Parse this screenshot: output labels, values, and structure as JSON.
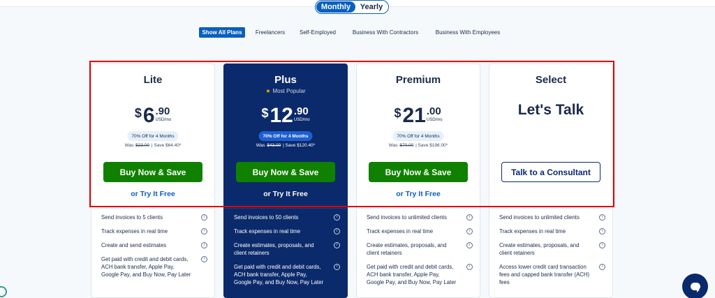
{
  "billing_toggle": {
    "monthly": "Monthly",
    "yearly": "Yearly"
  },
  "filters": [
    "Show All Plans",
    "Freelancers",
    "Self-Employed",
    "Business With Contractors",
    "Business With Employees"
  ],
  "plans": [
    {
      "name": "Lite",
      "currency": "$",
      "whole": "6",
      "cents": ".90",
      "unit": "USD/mo",
      "discount": "70% Off for 4 Months",
      "was_label": "Was",
      "was_price": "$23.00",
      "save": "| Save $64.40*",
      "cta": "Buy Now & Save",
      "try": "or Try It Free",
      "features": [
        "Send invoices to 5 clients",
        "Track expenses in real time",
        "Create and send estimates",
        "Get paid with credit and debit cards, ACH bank transfer, Apple Pay, Google Pay, and Buy Now, Pay Later"
      ]
    },
    {
      "name": "Plus",
      "badge": "Most Popular",
      "currency": "$",
      "whole": "12",
      "cents": ".90",
      "unit": "USD/mo",
      "discount": "70% Off for 4 Months",
      "was_label": "Was",
      "was_price": "$43.00",
      "save": "| Save $120.40*",
      "cta": "Buy Now & Save",
      "try": "or Try It Free",
      "features": [
        "Send invoices to 50 clients",
        "Track expenses in real time",
        "Create estimates, proposals, and client retainers",
        "Get paid with credit and debit cards, ACH bank transfer, Apple Pay, Google Pay, and Buy Now, Pay Later"
      ]
    },
    {
      "name": "Premium",
      "currency": "$",
      "whole": "21",
      "cents": ".00",
      "unit": "USD/mo",
      "discount": "70% Off for 4 Months",
      "was_label": "Was",
      "was_price": "$70.00",
      "save": "| Save $196.00*",
      "cta": "Buy Now & Save",
      "try": "or Try It Free",
      "features": [
        "Send invoices to unlimited clients",
        "Track expenses in real time",
        "Create estimates, proposals, and client retainers",
        "Get paid with credit and debit cards, ACH bank transfer, Apple Pay, Google Pay, and Buy Now, Pay Later"
      ]
    },
    {
      "name": "Select",
      "headline": "Let's Talk",
      "cta": "Talk to a Consultant",
      "features": [
        "Send invoices to unlimited clients",
        "Track expenses in real time",
        "Create estimates, proposals, and client retainers",
        "Access lower credit card transaction fees and capped bank transfer (ACH) fees"
      ]
    }
  ],
  "colors": {
    "brand_blue": "#0a5fbf",
    "navy": "#0b2a6b",
    "buy_green": "#108000",
    "highlight_red": "#e00000"
  },
  "icons": {
    "info": "info-icon",
    "star": "star-icon",
    "chat": "chat-icon"
  }
}
